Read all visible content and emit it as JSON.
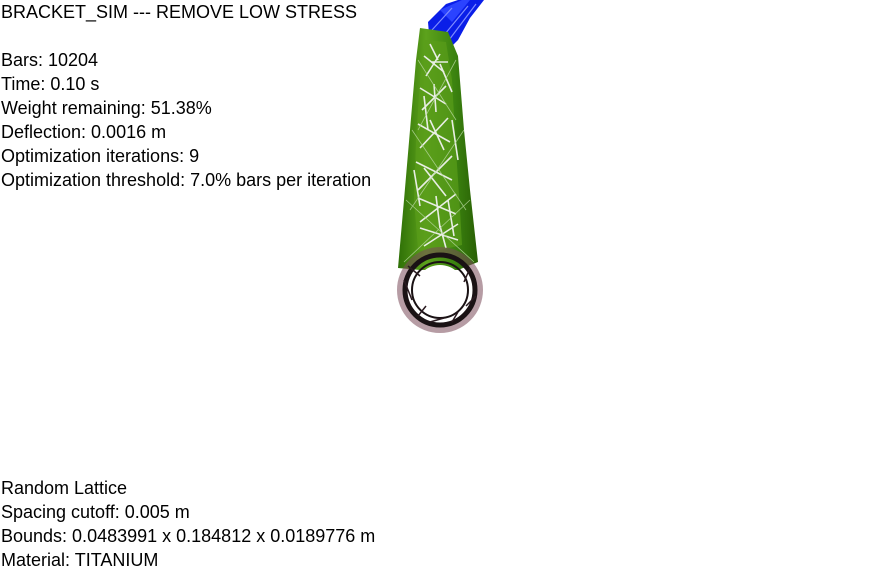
{
  "title": "BRACKET_SIM --- REMOVE LOW STRESS",
  "stats": {
    "bars": "Bars: 10204",
    "time": "Time: 0.10 s",
    "weight": "Weight remaining: 51.38%",
    "deflection": "Deflection: 0.0016 m",
    "iterations": "Optimization iterations: 9",
    "threshold": "Optimization threshold: 7.0% bars per iteration"
  },
  "info": {
    "lattice": "Random Lattice",
    "spacing": "Spacing cutoff: 0.005 m",
    "bounds": "Bounds: 0.0483991 x 0.184812 x 0.0189776 m",
    "material": "Material: TITANIUM"
  },
  "colors": {
    "background": "#ffffff",
    "text": "#000000",
    "body_green": "#3f8a10",
    "body_light_green": "#74b82a",
    "low_stress_white": "#e8eee4",
    "load_blue": "#0a1ee8",
    "ring_dark": "#1a1214",
    "ring_shadow": "#7a4a5a"
  }
}
